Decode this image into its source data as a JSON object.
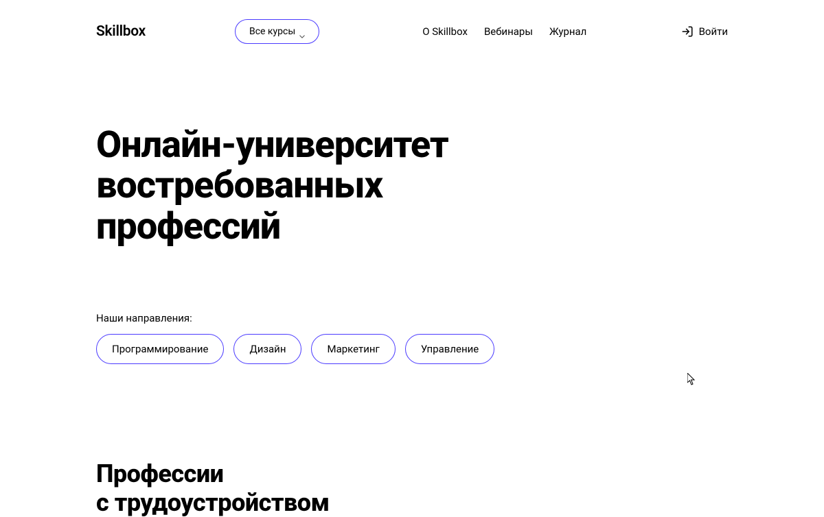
{
  "header": {
    "logo": "Skillbox",
    "allCoursesLabel": "Все курсы",
    "nav": [
      {
        "label": "О Skillbox"
      },
      {
        "label": "Вебинары"
      },
      {
        "label": "Журнал"
      }
    ],
    "loginLabel": "Войти"
  },
  "hero": {
    "titleLine1": "Онлайн-университет",
    "titleLine2": "востребованных",
    "titleLine3": "профессий"
  },
  "directions": {
    "label": "Наши направления:",
    "items": [
      {
        "label": "Программирование"
      },
      {
        "label": "Дизайн"
      },
      {
        "label": "Маркетинг"
      },
      {
        "label": "Управление"
      }
    ]
  },
  "section2": {
    "titleLine1": "Профессии",
    "titleLine2": "с трудоустройством"
  }
}
